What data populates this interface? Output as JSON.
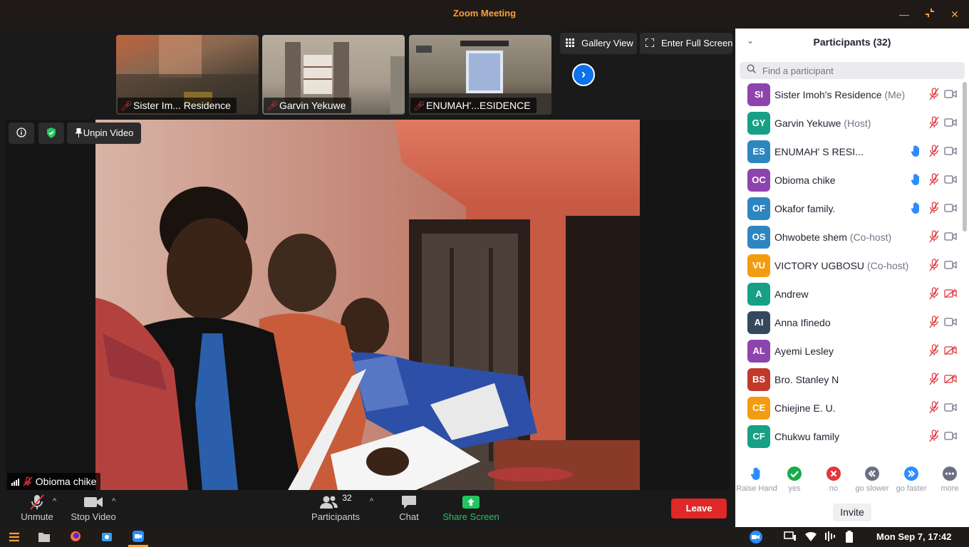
{
  "window": {
    "title": "Zoom Meeting"
  },
  "view_controls": {
    "gallery_view": "Gallery View",
    "full_screen": "Enter Full Screen"
  },
  "thumbnails": [
    {
      "name": "Sister Im... Residence"
    },
    {
      "name": "Garvin Yekuwe"
    },
    {
      "name": "ENUMAH'...ESIDENCE"
    }
  ],
  "video_overlay": {
    "unpin": "Unpin Video",
    "active_speaker": "Obioma chike"
  },
  "toolbar": {
    "unmute": "Unmute",
    "stop_video": "Stop Video",
    "participants": "Participants",
    "participant_count": "32",
    "chat": "Chat",
    "share_screen": "Share Screen",
    "leave": "Leave"
  },
  "panel": {
    "title": "Participants (32)",
    "search_placeholder": "Find a participant",
    "participants": [
      {
        "initials": "SI",
        "name": "Sister Imoh's Residence",
        "role": "(Me)",
        "color": "#8e44ad",
        "hand": false,
        "video_off": false
      },
      {
        "initials": "GY",
        "name": "Garvin Yekuwe",
        "role": "(Host)",
        "color": "#16a085",
        "hand": false,
        "video_off": false
      },
      {
        "initials": "ES",
        "name": "ENUMAH' S RESI...",
        "role": "",
        "color": "#2e86c1",
        "hand": true,
        "video_off": false
      },
      {
        "initials": "OC",
        "name": "Obioma chike",
        "role": "",
        "color": "#8e44ad",
        "hand": true,
        "video_off": false
      },
      {
        "initials": "OF",
        "name": "Okafor family.",
        "role": "",
        "color": "#2e86c1",
        "hand": true,
        "video_off": false
      },
      {
        "initials": "OS",
        "name": "Ohwobete shem",
        "role": "(Co-host)",
        "color": "#2e86c1",
        "hand": false,
        "video_off": false
      },
      {
        "initials": "VU",
        "name": "VICTORY UGBOSU",
        "role": "(Co-host)",
        "color": "#f39c12",
        "hand": false,
        "video_off": false
      },
      {
        "initials": "A",
        "name": "Andrew",
        "role": "",
        "color": "#16a085",
        "hand": false,
        "video_off": true
      },
      {
        "initials": "AI",
        "name": "Anna Ifinedo",
        "role": "",
        "color": "#34495e",
        "hand": false,
        "video_off": false
      },
      {
        "initials": "AL",
        "name": "Ayemi Lesley",
        "role": "",
        "color": "#8e44ad",
        "hand": false,
        "video_off": true
      },
      {
        "initials": "BS",
        "name": "Bro. Stanley N",
        "role": "",
        "color": "#c0392b",
        "hand": false,
        "video_off": true
      },
      {
        "initials": "CE",
        "name": "Chiejine E. U.",
        "role": "",
        "color": "#f39c12",
        "hand": false,
        "video_off": false
      },
      {
        "initials": "CF",
        "name": "Chukwu  family",
        "role": "",
        "color": "#16a085",
        "hand": false,
        "video_off": false
      }
    ],
    "reactions": [
      {
        "label": "Raise Hand",
        "icon": "raise-hand-icon"
      },
      {
        "label": "yes",
        "icon": "check-icon"
      },
      {
        "label": "no",
        "icon": "x-icon"
      },
      {
        "label": "go slower",
        "icon": "rewind-icon"
      },
      {
        "label": "go faster",
        "icon": "fast-forward-icon"
      },
      {
        "label": "more",
        "icon": "more-icon"
      }
    ],
    "invite": "Invite"
  },
  "taskbar": {
    "clock": "Mon Sep  7, 17:42"
  },
  "colors": {
    "accent_orange": "#ff9f3a",
    "zoom_blue": "#0e72ed",
    "leave_red": "#e02828",
    "share_green": "#22c55e"
  }
}
